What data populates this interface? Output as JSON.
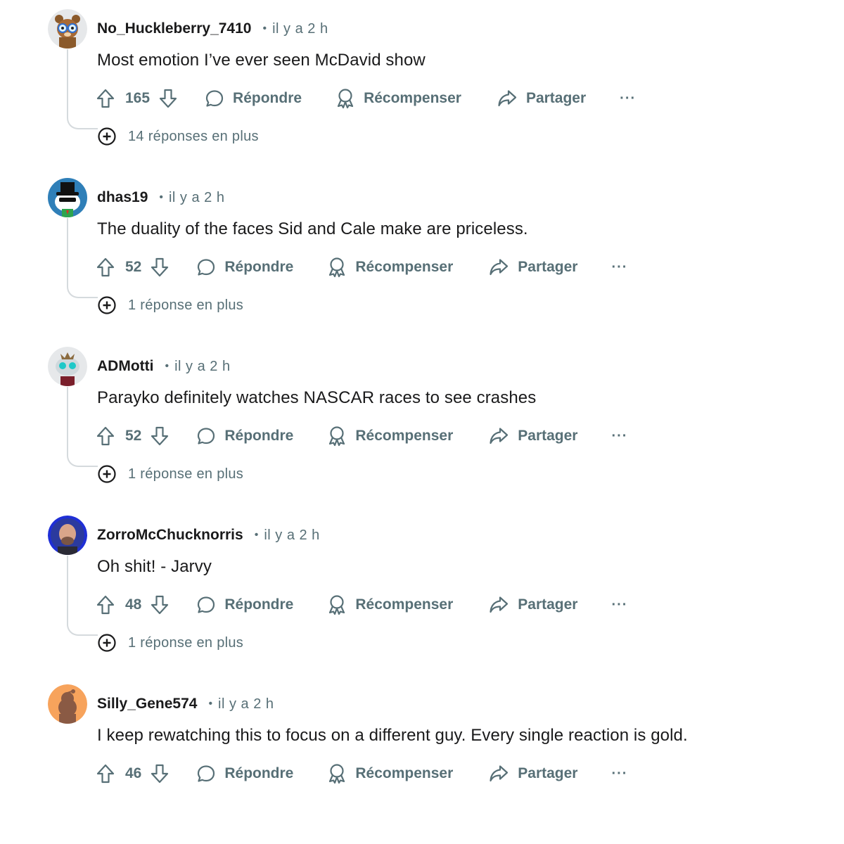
{
  "colors": {
    "meta": "#576f76",
    "text": "#1a1a1b",
    "thread_line": "#d5dadd"
  },
  "actions": {
    "reply_label": "Répondre",
    "award_label": "Récompenser",
    "share_label": "Partager",
    "more_label": "···",
    "icons": [
      "upvote-icon",
      "downvote-icon",
      "reply-icon",
      "award-icon",
      "share-icon",
      "more-icon"
    ]
  },
  "comments": [
    {
      "username": "No_Huckleberry_7410",
      "time": "il y a 2 h",
      "body": "Most emotion I’ve ever seen McDavid show",
      "votes": "165",
      "more_replies": "14 réponses en plus",
      "avatar": "bear-glasses-avatar"
    },
    {
      "username": "dhas19",
      "time": "il y a 2 h",
      "body": "The duality of the faces Sid and Cale make are priceless.",
      "votes": "52",
      "more_replies": "1 réponse en plus",
      "avatar": "snoo-top-hat-avatar"
    },
    {
      "username": "ADMotti",
      "time": "il y a 2 h",
      "body": "Parayko definitely watches NASCAR races to see crashes",
      "votes": "52",
      "more_replies": "1 réponse en plus",
      "avatar": "snoo-goggles-avatar"
    },
    {
      "username": "ZorroMcChucknorris",
      "time": "il y a 2 h",
      "body": "Oh shit! - Jarvy",
      "votes": "48",
      "more_replies": "1 réponse en plus",
      "avatar": "photo-avatar"
    },
    {
      "username": "Silly_Gene574",
      "time": "il y a 2 h",
      "body": "I keep rewatching this to focus on a different guy. Every single reaction is gold.",
      "votes": "46",
      "more_replies": "",
      "avatar": "default-snoo-avatar"
    }
  ]
}
